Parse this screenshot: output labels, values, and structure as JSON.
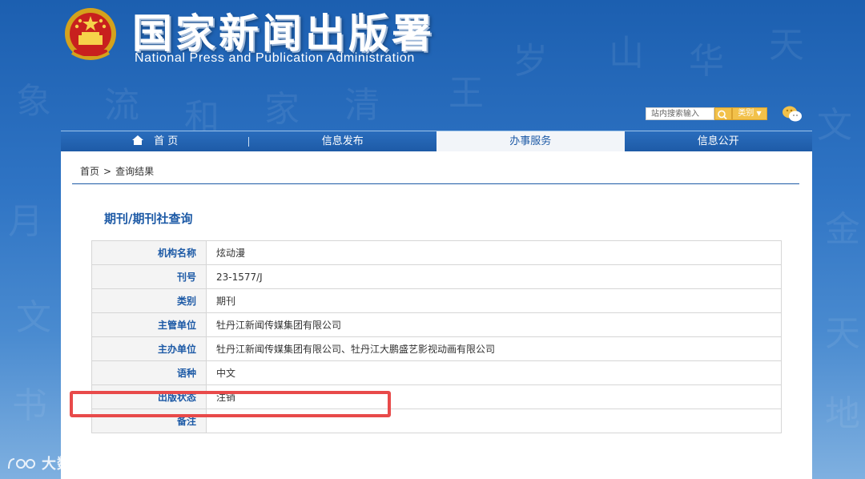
{
  "header": {
    "title": "国家新闻出版署",
    "subtitle": "National  Press and Publication Administration",
    "emblem_icon": "national-emblem-icon"
  },
  "search": {
    "placeholder": "站内搜索输入",
    "category_label": "类别",
    "search_icon": "search-icon",
    "wechat_icon": "wechat-icon"
  },
  "nav": {
    "items": [
      {
        "label": "首 页",
        "icon": "home-icon"
      },
      {
        "label": "信息发布"
      },
      {
        "label": "办事服务",
        "active": true
      },
      {
        "label": "信息公开"
      }
    ]
  },
  "breadcrumb": {
    "home": "首页",
    "sep": ">",
    "current": "查询结果"
  },
  "section": {
    "title": "期刊/期刊社查询"
  },
  "table": {
    "rows": [
      {
        "key": "机构名称",
        "value": "炫动漫"
      },
      {
        "key": "刊号",
        "value": "23-1577/J"
      },
      {
        "key": "类别",
        "value": "期刊"
      },
      {
        "key": "主管单位",
        "value": "牡丹江新闻传媒集团有限公司"
      },
      {
        "key": "主办单位",
        "value": "牡丹江新闻传媒集团有限公司、牡丹江大鹏盛艺影视动画有限公司"
      },
      {
        "key": "语种",
        "value": "中文"
      },
      {
        "key": "出版状态",
        "value": "注销"
      },
      {
        "key": "备注",
        "value": ""
      }
    ]
  },
  "watermark": {
    "text": "大数跨境"
  },
  "colors": {
    "brand_blue": "#1d5aa6",
    "highlight_red": "#e84a4a",
    "search_gold": "#f2c14a"
  }
}
